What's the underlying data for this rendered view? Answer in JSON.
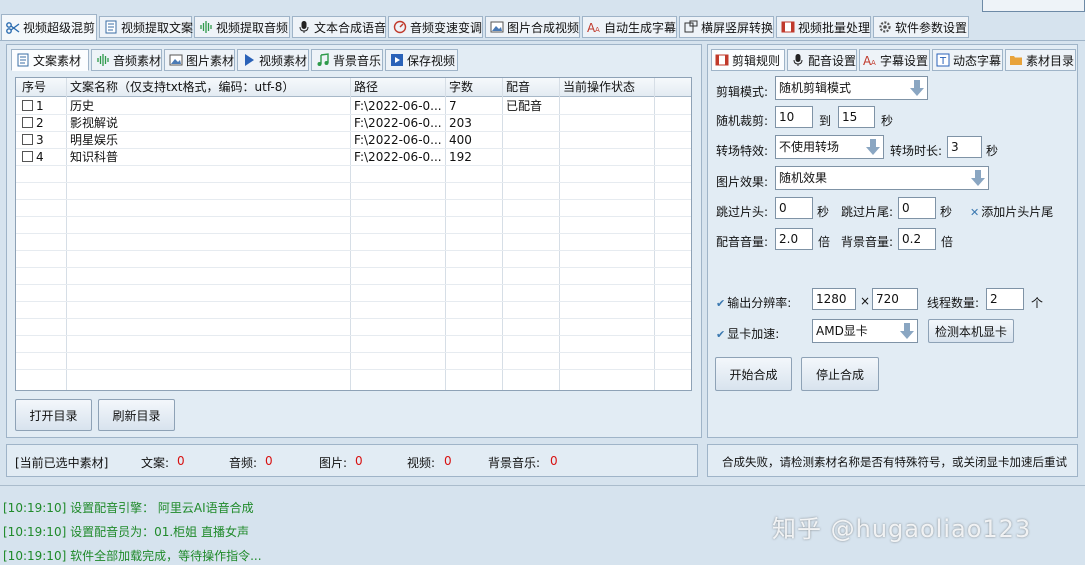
{
  "top_tabs": [
    {
      "label": "视频超级混剪",
      "icon": "scissors-icon",
      "active": true
    },
    {
      "label": "视频提取文案",
      "icon": "document-icon"
    },
    {
      "label": "视频提取音频",
      "icon": "waveform-icon"
    },
    {
      "label": "文本合成语音",
      "icon": "microphone-icon"
    },
    {
      "label": "音频变速变调",
      "icon": "speedometer-icon"
    },
    {
      "label": "图片合成视频",
      "icon": "image-icon"
    },
    {
      "label": "自动生成字幕",
      "icon": "font-icon"
    },
    {
      "label": "横屏竖屏转换",
      "icon": "rotate-screen-icon"
    },
    {
      "label": "视频批量处理",
      "icon": "film-icon"
    },
    {
      "label": "软件参数设置",
      "icon": "gear-icon"
    }
  ],
  "left": {
    "tabs": [
      {
        "label": "文案素材",
        "icon": "document-icon",
        "active": true
      },
      {
        "label": "音频素材",
        "icon": "waveform-icon"
      },
      {
        "label": "图片素材",
        "icon": "image-icon"
      },
      {
        "label": "视频素材",
        "icon": "play-icon"
      },
      {
        "label": "背景音乐",
        "icon": "music-note-icon"
      },
      {
        "label": "保存视频",
        "icon": "play-box-icon"
      }
    ],
    "columns": [
      "序号",
      "文案名称（仅支持txt格式，编码：utf-8）",
      "路径",
      "字数",
      "配音",
      "当前操作状态"
    ],
    "rows": [
      {
        "no": "1",
        "name": "历史",
        "path": "F:\\2022-06-0...",
        "count": "7",
        "dub": "已配音",
        "status": ""
      },
      {
        "no": "2",
        "name": "影视解说",
        "path": "F:\\2022-06-0...",
        "count": "203",
        "dub": "",
        "status": ""
      },
      {
        "no": "3",
        "name": "明星娱乐",
        "path": "F:\\2022-06-0...",
        "count": "400",
        "dub": "",
        "status": ""
      },
      {
        "no": "4",
        "name": "知识科普",
        "path": "F:\\2022-06-0...",
        "count": "192",
        "dub": "",
        "status": ""
      }
    ],
    "open_dir": "打开目录",
    "refresh_dir": "刷新目录"
  },
  "right": {
    "tabs": [
      {
        "label": "剪辑规则",
        "icon": "film-icon",
        "active": true
      },
      {
        "label": "配音设置",
        "icon": "microphone-icon"
      },
      {
        "label": "字幕设置",
        "icon": "font-icon"
      },
      {
        "label": "动态字幕",
        "icon": "text-box-icon"
      },
      {
        "label": "素材目录",
        "icon": "folder-icon"
      }
    ],
    "edit_mode_label": "剪辑模式:",
    "edit_mode_value": "随机剪辑模式",
    "random_cut_label": "随机裁剪:",
    "random_cut_from": "10",
    "to_label": "到",
    "random_cut_to": "15",
    "sec_unit": "秒",
    "transition_label": "转场特效:",
    "transition_value": "不使用转场",
    "transition_dur_label": "转场时长:",
    "transition_dur_value": "3",
    "image_effect_label": "图片效果:",
    "image_effect_value": "随机效果",
    "skip_head_label": "跳过片头:",
    "skip_head_value": "0",
    "skip_tail_label": "跳过片尾:",
    "skip_tail_value": "0",
    "add_head_tail_label": "添加片头片尾",
    "dub_volume_label": "配音音量:",
    "dub_volume_value": "2.0",
    "times_unit": "倍",
    "bg_volume_label": "背景音量:",
    "bg_volume_value": "0.2",
    "output_res_label": "输出分辨率:",
    "res_width": "1280",
    "res_x": "×",
    "res_height": "720",
    "threads_label": "线程数量:",
    "threads_value": "2",
    "threads_unit": "个",
    "gpu_label": "显卡加速:",
    "gpu_value": "AMD显卡",
    "detect_gpu": "检测本机显卡",
    "start": "开始合成",
    "stop": "停止合成"
  },
  "selection": {
    "title": "[当前已选中素材]",
    "text_label": "文案:",
    "text_value": "0",
    "audio_label": "音频:",
    "audio_value": "0",
    "image_label": "图片:",
    "image_value": "0",
    "video_label": "视频:",
    "video_value": "0",
    "bgm_label": "背景音乐:",
    "bgm_value": "0"
  },
  "message": "合成失败，请检测素材名称是否有特殊符号，或关闭显卡加速后重试",
  "log": [
    "[10:19:10] 设置配音引擎： 阿里云AI语音合成",
    "[10:19:10] 设置配音员为：01.柜姐 直播女声",
    "[10:19:10] 软件全部加载完成，等待操作指令..."
  ],
  "watermark": "知乎 @hugaoliao123"
}
